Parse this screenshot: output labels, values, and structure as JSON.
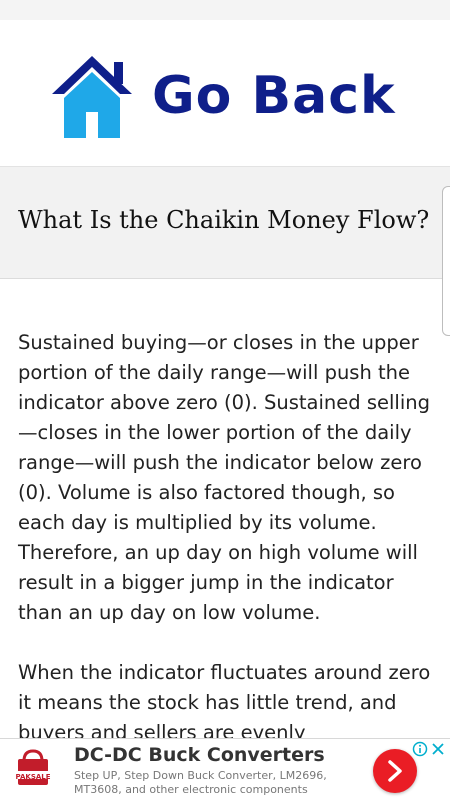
{
  "header": {
    "go_back_label": "Go Back",
    "home_icon": "home-icon"
  },
  "article": {
    "title": "What Is the Chaikin Money Flow?",
    "paragraphs": [
      "Sustained buying—or closes in the upper portion of the daily range—will push the indicator above zero (0). Sustained selling—closes in the lower portion of the daily range—will push the indicator below zero (0). Volume is also factored though, so each day is multiplied by its volume. Therefore, an up day on high volume will result in a bigger jump in the indicator than an up day on low volume.",
      "When the indicator fluctuates around zero it means the stock has little trend, and buyers and sellers are evenly"
    ]
  },
  "ad": {
    "logo_text": "PAKSALE",
    "title": "DC-DC Buck Converters",
    "description": "Step UP, Step Down Buck Converter, LM2696, MT3608, and other electronic components",
    "info_icon": "info-icon",
    "close_icon": "close-icon",
    "go_icon": "chevron-right-icon"
  },
  "colors": {
    "brand_blue": "#0f1f8a",
    "house_cyan": "#1fa8e8",
    "ad_red": "#ea1d25",
    "ad_blue": "#00aecd"
  }
}
